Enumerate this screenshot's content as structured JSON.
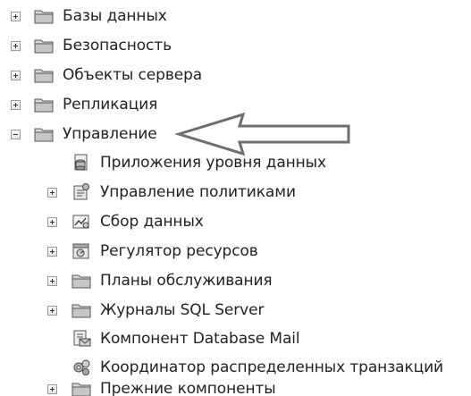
{
  "tree": {
    "top_nodes": [
      {
        "label": "Базы данных",
        "icon": "folder-icon"
      },
      {
        "label": "Безопасность",
        "icon": "folder-icon"
      },
      {
        "label": "Объекты сервера",
        "icon": "folder-icon"
      },
      {
        "label": "Репликация",
        "icon": "folder-icon"
      },
      {
        "label": "Управление",
        "icon": "folder-icon",
        "expanded": true
      }
    ],
    "management_children": [
      {
        "label": "Приложения уровня данных",
        "icon": "data-tier-app-icon"
      },
      {
        "label": "Управление политиками",
        "icon": "policy-management-icon"
      },
      {
        "label": "Сбор данных",
        "icon": "data-collection-icon"
      },
      {
        "label": "Регулятор ресурсов",
        "icon": "resource-governor-icon"
      },
      {
        "label": "Планы обслуживания",
        "icon": "folder-icon"
      },
      {
        "label": "Журналы SQL Server",
        "icon": "folder-icon"
      },
      {
        "label": "Компонент Database Mail",
        "icon": "database-mail-icon"
      },
      {
        "label": "Координатор распределенных транзакций",
        "icon": "dtc-icon"
      },
      {
        "label": "Прежние компоненты",
        "icon": "folder-icon"
      }
    ]
  },
  "annotation": {
    "icon": "outline-arrow-icon"
  }
}
